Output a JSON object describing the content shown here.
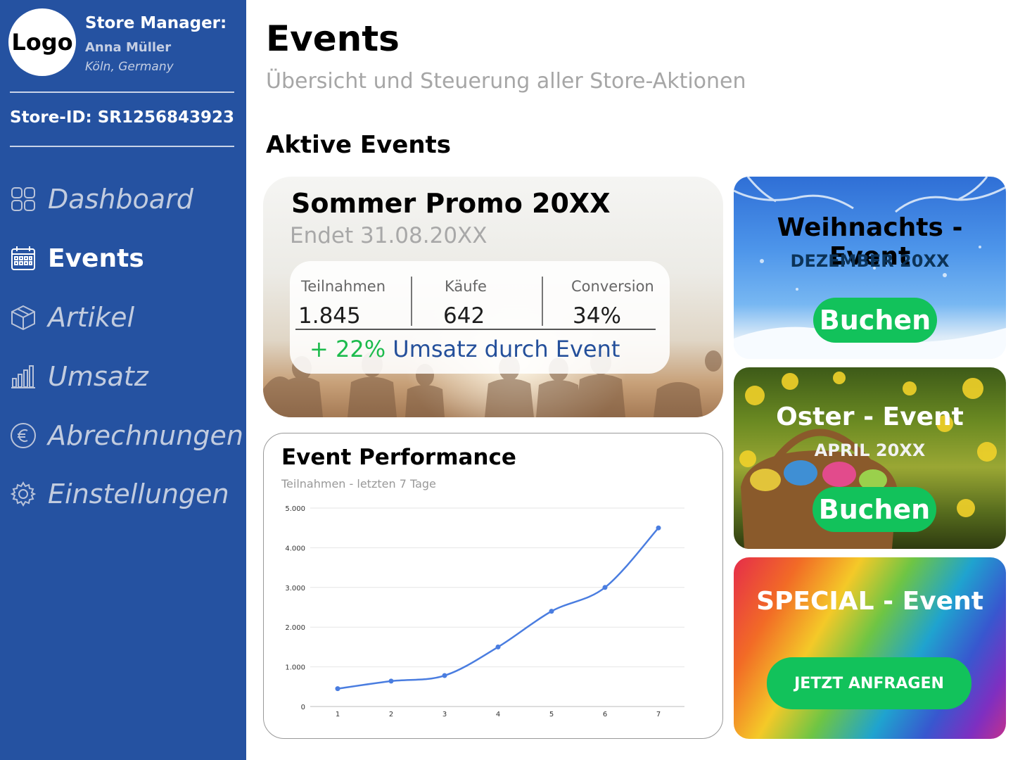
{
  "sidebar": {
    "logo": "Logo",
    "manager_title": "Store Manager:",
    "manager_name": "Anna Müller",
    "location": "Köln, Germany",
    "store_id": "Store-ID: SR1256843923",
    "items": [
      {
        "label": "Dashboard",
        "icon": "grid-icon",
        "active": false
      },
      {
        "label": "Events",
        "icon": "calendar-icon",
        "active": true
      },
      {
        "label": "Artikel",
        "icon": "box-icon",
        "active": false
      },
      {
        "label": "Umsatz",
        "icon": "bar-chart-icon",
        "active": false
      },
      {
        "label": "Abrechnungen",
        "icon": "euro-icon",
        "active": false
      },
      {
        "label": "Einstellungen",
        "icon": "gear-icon",
        "active": false
      }
    ]
  },
  "header": {
    "title": "Events",
    "subtitle": "Übersicht und Steuerung aller Store-Aktionen"
  },
  "section_title": "Aktive Events",
  "summer_card": {
    "title": "Sommer Promo 20XX",
    "end": "Endet 31.08.20XX",
    "stats": [
      {
        "label": "Teilnahmen",
        "value": "1.845"
      },
      {
        "label": "Käufe",
        "value": "642"
      },
      {
        "label": "Conversion",
        "value": "34%"
      }
    ],
    "uplift_pct": "+ 22%",
    "uplift_text": "Umsatz durch Event"
  },
  "performance": {
    "title": "Event Performance",
    "subtitle": "Teilnahmen - letzten 7 Tage"
  },
  "chart_data": {
    "type": "line",
    "title": "Event Performance",
    "subtitle": "Teilnahmen - letzten 7 Tage",
    "x": [
      1,
      2,
      3,
      4,
      5,
      6,
      7
    ],
    "series": [
      {
        "values": [
          450,
          640,
          780,
          1500,
          2400,
          3000,
          4500
        ]
      }
    ],
    "ylim": [
      0,
      5000
    ],
    "yticks": [
      "0",
      "1.000",
      "2.000",
      "3.000",
      "4.000",
      "5.000"
    ],
    "xticks": [
      "1",
      "2",
      "3",
      "4",
      "5",
      "6",
      "7"
    ],
    "grid": true,
    "line_color": "#4a7de0"
  },
  "events": [
    {
      "title": "Weihnachts - Event",
      "date": "DEZEMBER 20XX",
      "button": "Buchen"
    },
    {
      "title": "Oster - Event",
      "date": "APRIL 20XX",
      "button": "Buchen"
    },
    {
      "title": "SPECIAL - Event",
      "date": "",
      "button": "JETZT ANFRAGEN"
    }
  ],
  "colors": {
    "sidebar_bg": "#2552a1",
    "accent_green": "#12c25b",
    "uplift_green": "#1dbb4d",
    "uplift_blue": "#25509b"
  }
}
